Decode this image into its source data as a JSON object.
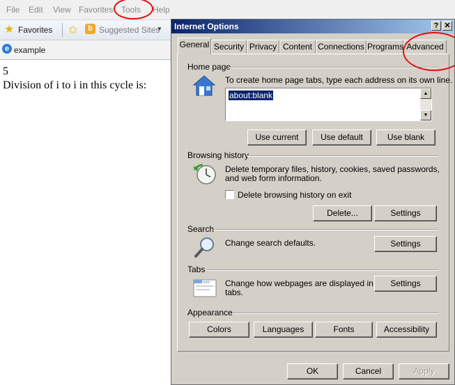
{
  "browser": {
    "menu": [
      "File",
      "Edit",
      "View",
      "Favorites",
      "Tools",
      "Help"
    ],
    "favorites_label": "Favorites",
    "suggested_sites_label": "Suggested Sites",
    "tab_title": "example",
    "content_lines": [
      "5",
      "Division of i to i in this cycle is:"
    ]
  },
  "dialog": {
    "title": "Internet Options",
    "help_button": "?",
    "close_button": "✕",
    "tabs": [
      "General",
      "Security",
      "Privacy",
      "Content",
      "Connections",
      "Programs",
      "Advanced"
    ],
    "home_page": {
      "label": "Home page",
      "description": "To create home page tabs, type each address on its own line.",
      "value": "about:blank",
      "buttons": [
        "Use current",
        "Use default",
        "Use blank"
      ]
    },
    "browsing_history": {
      "label": "Browsing history",
      "description_line1": "Delete temporary files, history, cookies, saved passwords,",
      "description_line2": "and web form information.",
      "checkbox_label": "Delete browsing history on exit",
      "buttons": [
        "Delete...",
        "Settings"
      ]
    },
    "search": {
      "label": "Search",
      "description": "Change search defaults.",
      "button": "Settings"
    },
    "tabs_section": {
      "label": "Tabs",
      "description_line1": "Change how webpages are displayed in",
      "description_line2": "tabs.",
      "button": "Settings"
    },
    "appearance": {
      "label": "Appearance",
      "buttons": [
        "Colors",
        "Languages",
        "Fonts",
        "Accessibility"
      ]
    },
    "footer_buttons": [
      "OK",
      "Cancel",
      "Apply"
    ]
  }
}
